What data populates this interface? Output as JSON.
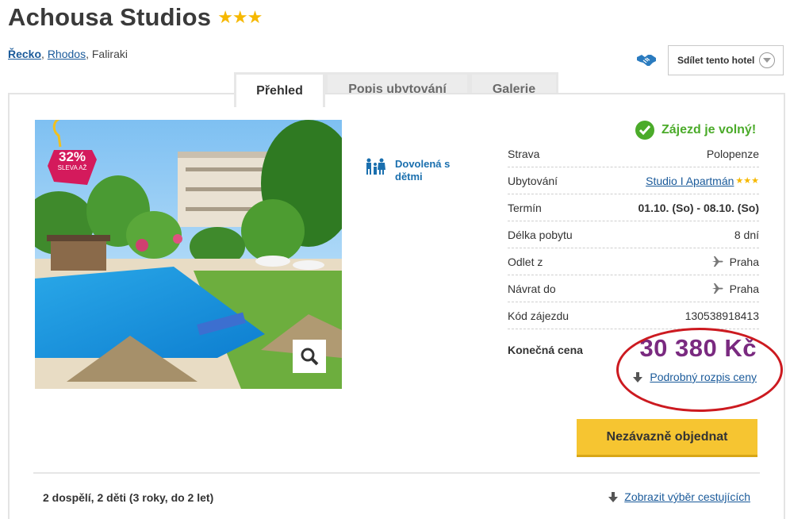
{
  "hotel": {
    "name": "Achousa Studios",
    "stars": "★★★"
  },
  "breadcrumb": {
    "country": "Řecko",
    "region": "Rhodos",
    "place": "Faliraki"
  },
  "share": {
    "label": "Sdílet tento hotel"
  },
  "tabs": [
    {
      "label": "Přehled",
      "active": true
    },
    {
      "label": "Popis ubytování",
      "active": false
    },
    {
      "label": "Galerie",
      "active": false
    }
  ],
  "photo": {
    "discount_percent": "32%",
    "discount_label": "SLEVA AŽ"
  },
  "feature": {
    "label": "Dovolená s dětmi"
  },
  "availability": {
    "text": "Zájezd je volný!"
  },
  "info_rows": [
    {
      "label": "Strava",
      "value": "Polopenze"
    },
    {
      "label": "Ubytování",
      "value": "Studio I Apartmán",
      "stars": "★★★"
    },
    {
      "label": "Termín",
      "value": "01.10. (So) - 08.10. (So)"
    },
    {
      "label": "Délka pobytu",
      "value": "8 dní"
    },
    {
      "label": "Odlet z",
      "value": "Praha"
    },
    {
      "label": "Návrat do",
      "value": "Praha"
    },
    {
      "label": "Kód zájezdu",
      "value": "130538918413"
    }
  ],
  "price": {
    "label": "Konečná cena",
    "value": "30 380 Kč",
    "breakdown_link": "Podrobný rozpis ceny"
  },
  "order_button": {
    "label": "Nezávazně objednat"
  },
  "travelers": {
    "summary": "2 dospělí, 2 děti (3 roky, do 2 let)",
    "link": "Zobrazit výběr cestujících"
  },
  "colors": {
    "price": "#7a2a80",
    "available": "#4bab2a",
    "link": "#1a5a9a",
    "order_button": "#f6c531",
    "highlight_ellipse": "#cc1a20"
  }
}
